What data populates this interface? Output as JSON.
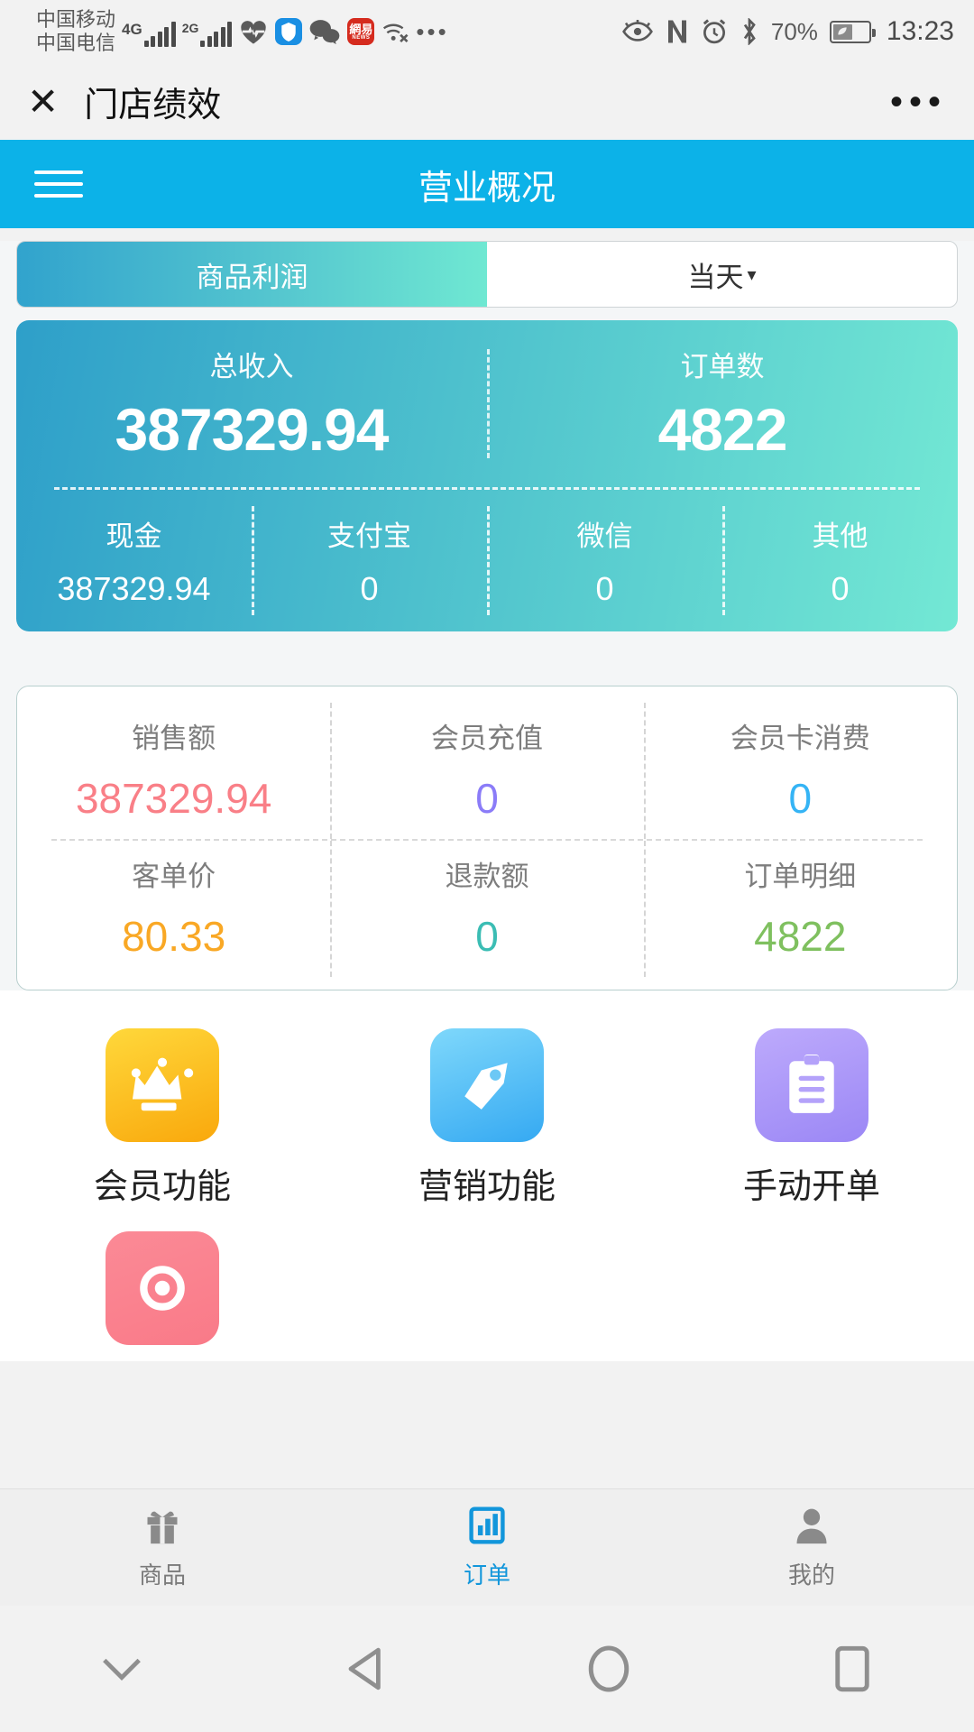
{
  "status_bar": {
    "carrier_top": "中国移动",
    "carrier_bottom": "中国电信",
    "network_1": "4G",
    "network_2": "2G",
    "icons": [
      "heart-rate-icon",
      "shield-icon",
      "wechat-icon",
      "netease-news-icon",
      "wifi-off-icon",
      "overflow-dots-icon"
    ],
    "netease_text": "網易",
    "netease_sub": "NEWS",
    "more_dots": "•••",
    "right_icons": [
      "eye-care-icon",
      "nfc-icon",
      "alarm-icon",
      "bluetooth-icon"
    ],
    "battery_percent": "70%",
    "time": "13:23"
  },
  "miniprogram_bar": {
    "close_label": "✕",
    "title": "门店绩效",
    "more_label": "•••"
  },
  "app_bar": {
    "menu_icon": "hamburger-icon",
    "title": "营业概况"
  },
  "tabs": {
    "items": [
      {
        "label": "商品利润",
        "active": true
      },
      {
        "label": "当天",
        "caret": "▾",
        "active": false
      }
    ]
  },
  "hero": {
    "primary": [
      {
        "label": "总收入",
        "value": "387329.94"
      },
      {
        "label": "订单数",
        "value": "4822"
      }
    ],
    "payments": [
      {
        "label": "现金",
        "value": "387329.94"
      },
      {
        "label": "支付宝",
        "value": "0"
      },
      {
        "label": "微信",
        "value": "0"
      },
      {
        "label": "其他",
        "value": "0"
      }
    ]
  },
  "metrics": {
    "row1": [
      {
        "label": "销售额",
        "value": "387329.94",
        "color": "#f97f87"
      },
      {
        "label": "会员充值",
        "value": "0",
        "color": "#8b7cf8"
      },
      {
        "label": "会员卡消费",
        "value": "0",
        "color": "#35b4f5"
      }
    ],
    "row2": [
      {
        "label": "客单价",
        "value": "80.33",
        "color": "#f9a825"
      },
      {
        "label": "退款额",
        "value": "0",
        "color": "#3bbdb4"
      },
      {
        "label": "订单明细",
        "value": "4822",
        "color": "#7fc05f"
      }
    ]
  },
  "shortcuts": [
    {
      "label": "会员功能",
      "icon": "crown-icon",
      "color_start": "#ffd83b",
      "color_end": "#f9a80c"
    },
    {
      "label": "营销功能",
      "icon": "price-tag-icon",
      "color_start": "#7fd8fb",
      "color_end": "#35a9f2"
    },
    {
      "label": "手动开单",
      "icon": "clipboard-icon",
      "color_start": "#bdaafc",
      "color_end": "#9b87f5"
    },
    {
      "label": "",
      "icon": "location-icon",
      "color_start": "#fb8a96",
      "color_end": "#f97a88"
    }
  ],
  "bottom_nav": [
    {
      "label": "商品",
      "icon": "gift-icon",
      "active": false
    },
    {
      "label": "订单",
      "icon": "bar-chart-icon",
      "active": true
    },
    {
      "label": "我的",
      "icon": "person-icon",
      "active": false
    }
  ],
  "system_nav": [
    "chevron-down-icon",
    "back-triangle-icon",
    "home-circle-icon",
    "recents-square-icon"
  ],
  "colors": {
    "accent": "#0cb2e8",
    "nav_active": "#1296db",
    "gradient_start": "#2e9fc9",
    "gradient_end": "#73e8d4"
  }
}
